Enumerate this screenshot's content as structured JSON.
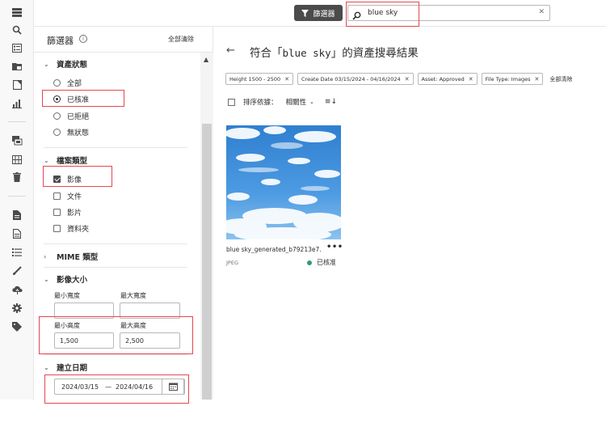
{
  "topbar": {
    "filter_button_label": "篩選器",
    "search_value": "blue sky",
    "clear_icon": "close-icon"
  },
  "rail": {
    "icons": [
      "menu-icon",
      "search-icon",
      "list-icon",
      "folder-image-icon",
      "bookmark-icon",
      "bar-chart-icon",
      "collections-icon",
      "grid-icon",
      "trash-icon",
      "document-icon",
      "file-icon",
      "checklist-icon",
      "brush-icon",
      "cloud-upload-icon",
      "gear-icon",
      "tag-icon"
    ]
  },
  "filters": {
    "title": "篩選器",
    "clear_all": "全部清除",
    "asset_status": {
      "heading": "資產狀態",
      "options": [
        {
          "label": "全部",
          "selected": false
        },
        {
          "label": "已核准",
          "selected": true
        },
        {
          "label": "已拒絕",
          "selected": false
        },
        {
          "label": "無狀態",
          "selected": false
        }
      ]
    },
    "file_type": {
      "heading": "檔案類型",
      "options": [
        {
          "label": "影像",
          "checked": true
        },
        {
          "label": "文件",
          "checked": false
        },
        {
          "label": "影片",
          "checked": false
        },
        {
          "label": "資料夾",
          "checked": false
        }
      ]
    },
    "mime": {
      "heading": "MIME 類型"
    },
    "image_size": {
      "heading": "影像大小",
      "min_width_label": "最小寬度",
      "max_width_label": "最大寬度",
      "min_width_value": "",
      "max_width_value": "",
      "min_height_label": "最小高度",
      "max_height_label": "最大高度",
      "min_height_value": "1,500",
      "max_height_value": "2,500"
    },
    "created_date": {
      "heading": "建立日期",
      "from": "2024/03/15",
      "separator": "—",
      "to": "2024/04/16"
    }
  },
  "main": {
    "title_prefix": "符合「",
    "query": "blue sky",
    "title_suffix": "」的資產搜尋結果",
    "tags": [
      "Height 1500 - 2500",
      "Create Date 03/15/2024 - 04/16/2024",
      "Asset: Approved",
      "File Type: Images"
    ],
    "tags_clear_all": "全部清除",
    "sort_label": "排序依據：",
    "sort_value": "相關性",
    "asset": {
      "name": "blue sky_generated_b79213e7...",
      "more": "•••",
      "type": "JPEG",
      "status": "已核准",
      "status_color": "#2d9d78"
    }
  },
  "colors": {
    "highlight": "#e34850",
    "filter_button": "#4b4b4b"
  }
}
